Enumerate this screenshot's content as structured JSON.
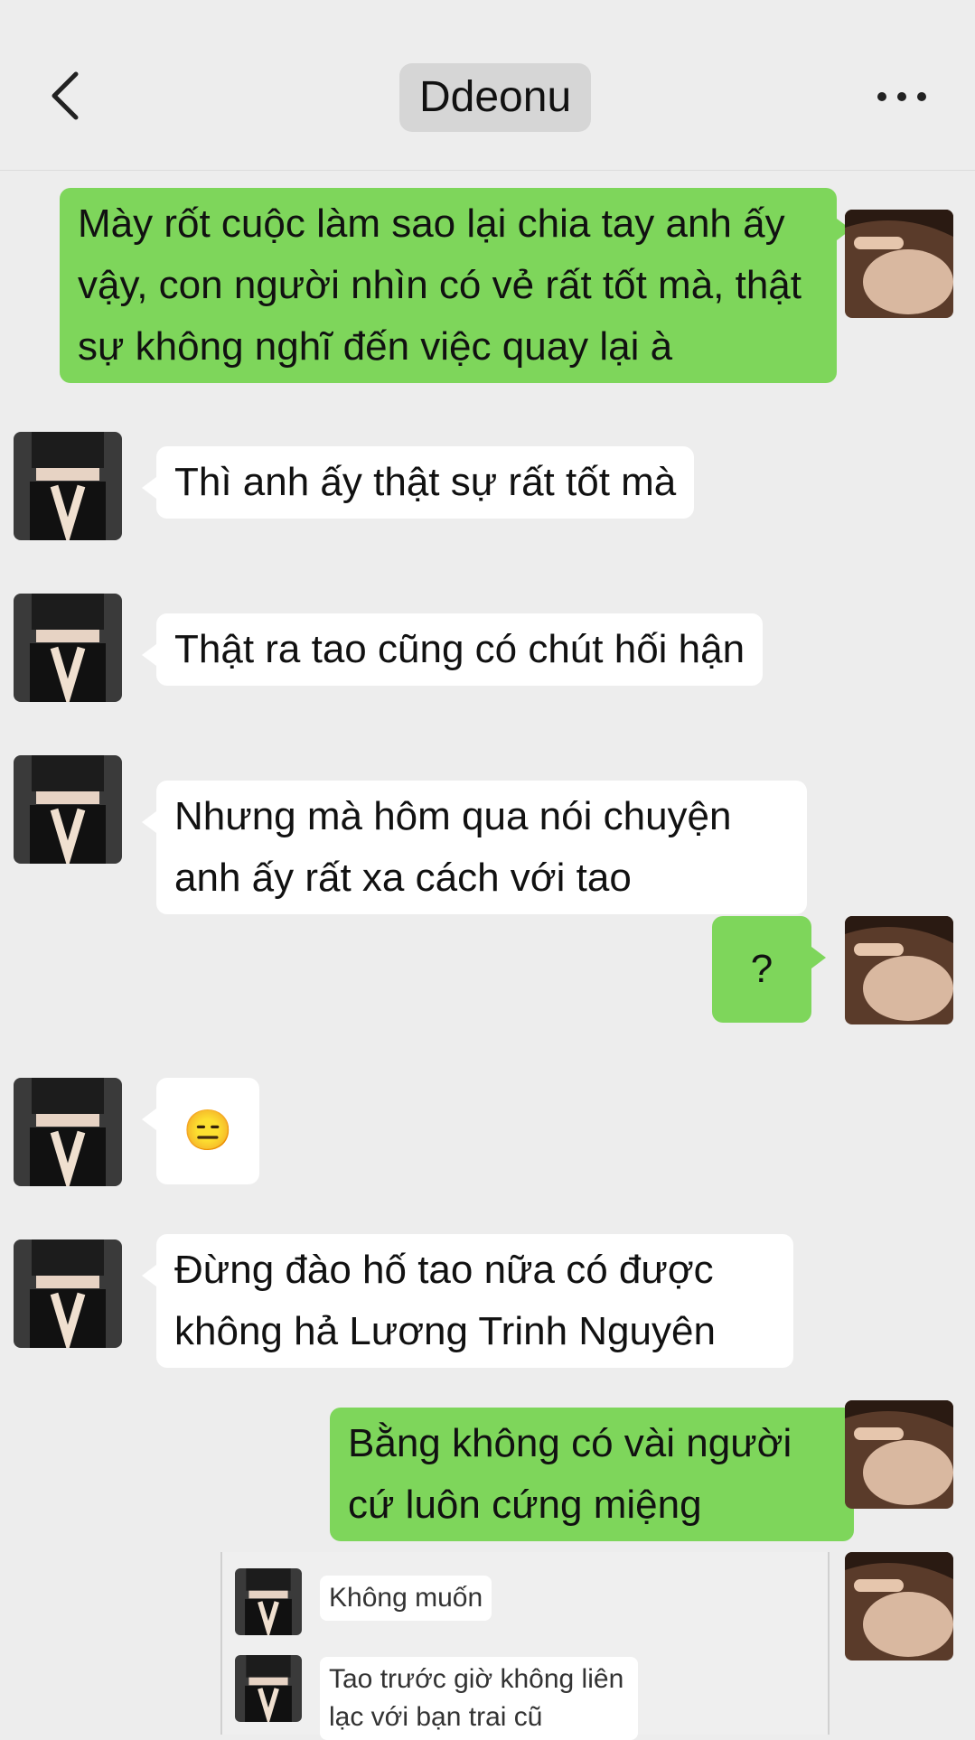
{
  "header": {
    "title": "Ddeonu",
    "back_icon": "chevron-left-icon",
    "more_icon": "more-dots-icon"
  },
  "messages": [
    {
      "from": "me",
      "text": "Mày rốt cuộc làm sao lại chia tay anh ấy vậy, con người nhìn có vẻ rất tốt mà, thật sự không nghĩ đến việc quay lại à"
    },
    {
      "from": "them",
      "text": "Thì anh ấy thật sự rất tốt mà"
    },
    {
      "from": "them",
      "text": "Thật ra tao cũng có chút hối hận"
    },
    {
      "from": "them",
      "text": "Nhưng mà hôm qua nói chuyện anh ấy rất xa cách với tao"
    },
    {
      "from": "me",
      "text": "?"
    },
    {
      "from": "them",
      "text": "😑"
    },
    {
      "from": "them",
      "text": "Đừng đào hố tao nữa có được không hả Lương Trinh Nguyên"
    },
    {
      "from": "me",
      "text": "Bằng không có vài người cứ luôn cứng miệng"
    }
  ],
  "quoted": [
    {
      "text": "Không muốn"
    },
    {
      "text": "Tao trước giờ không liên lạc với bạn trai cũ"
    }
  ],
  "colors": {
    "background": "#ededed",
    "me_bubble": "#7ed65b",
    "them_bubble": "#ffffff"
  }
}
